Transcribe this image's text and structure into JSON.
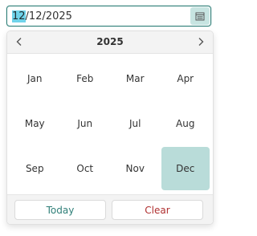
{
  "date_input": {
    "value_selected_part": "12",
    "value_rest": "/12/2025",
    "calendar_icon": "calendar-icon"
  },
  "calendar": {
    "year": "2025",
    "prev_icon": "chevron-left-icon",
    "next_icon": "chevron-right-icon",
    "months": [
      "Jan",
      "Feb",
      "Mar",
      "Apr",
      "May",
      "Jun",
      "Jul",
      "Aug",
      "Sep",
      "Oct",
      "Nov",
      "Dec"
    ],
    "selected_month": "Dec"
  },
  "footer": {
    "today_label": "Today",
    "clear_label": "Clear"
  },
  "colors": {
    "accent": "#2f7f78",
    "selected_bg": "#b9dcd9",
    "text_highlight": "#6fd3ea",
    "clear_text": "#b03030"
  }
}
